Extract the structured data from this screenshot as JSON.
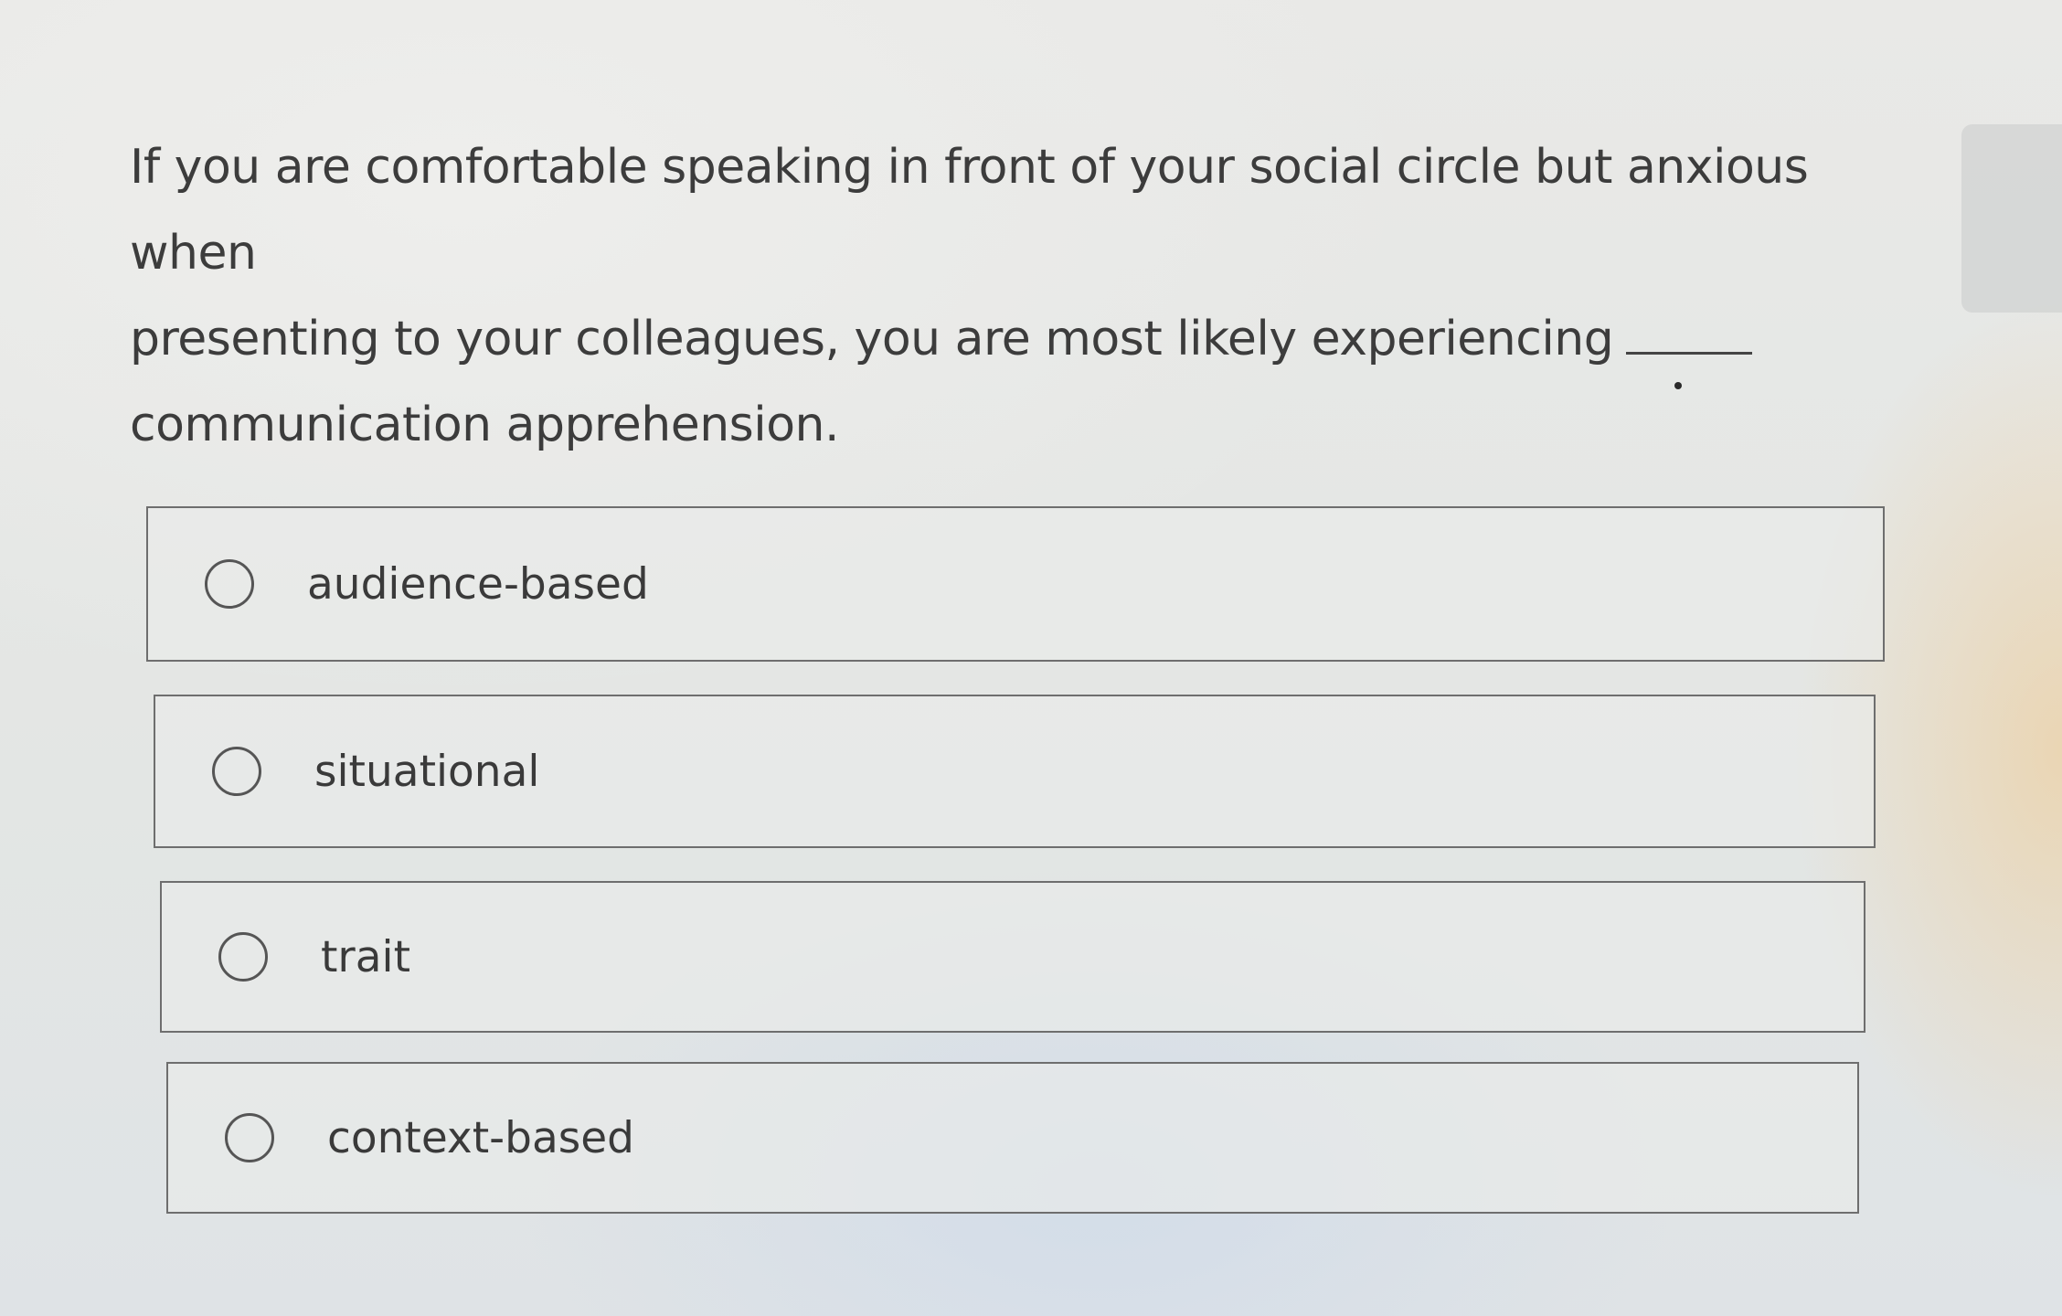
{
  "question": {
    "line1": "If you are comfortable speaking in front of your social circle but anxious when",
    "line2": "presenting to your colleagues, you are most likely experiencing",
    "line3": "communication apprehension."
  },
  "options": [
    {
      "label": "audience-based",
      "selected": false
    },
    {
      "label": "situational",
      "selected": false
    },
    {
      "label": "trait",
      "selected": false
    },
    {
      "label": "context-based",
      "selected": false
    }
  ]
}
